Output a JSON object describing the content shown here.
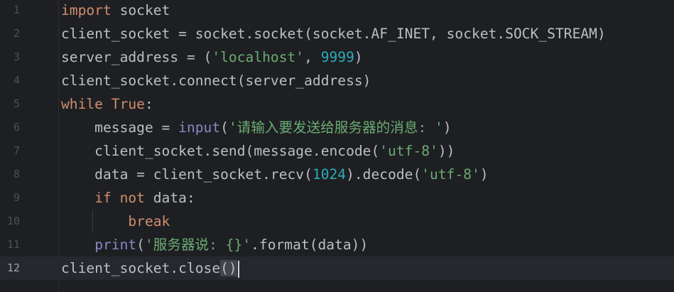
{
  "editor": {
    "lines": [
      {
        "num": "1",
        "tokens": [
          {
            "t": "import",
            "c": "kw"
          },
          {
            "t": " socket",
            "c": ""
          }
        ]
      },
      {
        "num": "2",
        "tokens": [
          {
            "t": "client_socket = socket.socket(socket.AF_INET, socket.SOCK_STREAM)",
            "c": ""
          }
        ]
      },
      {
        "num": "3",
        "tokens": [
          {
            "t": "server_address = (",
            "c": ""
          },
          {
            "t": "'localhost'",
            "c": "str"
          },
          {
            "t": ", ",
            "c": ""
          },
          {
            "t": "9999",
            "c": "num"
          },
          {
            "t": ")",
            "c": ""
          }
        ]
      },
      {
        "num": "4",
        "tokens": [
          {
            "t": "client_socket.connect(server_address)",
            "c": ""
          }
        ]
      },
      {
        "num": "5",
        "tokens": [
          {
            "t": "while",
            "c": "kw"
          },
          {
            "t": " ",
            "c": ""
          },
          {
            "t": "True",
            "c": "kw"
          },
          {
            "t": ":",
            "c": ""
          }
        ]
      },
      {
        "num": "6",
        "tokens": [
          {
            "t": "    message = ",
            "c": ""
          },
          {
            "t": "input",
            "c": "bi"
          },
          {
            "t": "(",
            "c": ""
          },
          {
            "t": "'请输入要发送给服务器的消息: '",
            "c": "str"
          },
          {
            "t": ")",
            "c": ""
          }
        ]
      },
      {
        "num": "7",
        "tokens": [
          {
            "t": "    client_socket.send(message.encode(",
            "c": ""
          },
          {
            "t": "'utf-8'",
            "c": "str"
          },
          {
            "t": "))",
            "c": ""
          }
        ]
      },
      {
        "num": "8",
        "tokens": [
          {
            "t": "    data = client_socket.recv(",
            "c": ""
          },
          {
            "t": "1024",
            "c": "num"
          },
          {
            "t": ").decode(",
            "c": ""
          },
          {
            "t": "'utf-8'",
            "c": "str"
          },
          {
            "t": ")",
            "c": ""
          }
        ]
      },
      {
        "num": "9",
        "tokens": [
          {
            "t": "    ",
            "c": ""
          },
          {
            "t": "if",
            "c": "kw"
          },
          {
            "t": " ",
            "c": ""
          },
          {
            "t": "not",
            "c": "kw"
          },
          {
            "t": " data:",
            "c": ""
          }
        ]
      },
      {
        "num": "10",
        "tokens": [
          {
            "t": "        ",
            "c": ""
          },
          {
            "t": "break",
            "c": "kw"
          }
        ]
      },
      {
        "num": "11",
        "tokens": [
          {
            "t": "    ",
            "c": ""
          },
          {
            "t": "print",
            "c": "bi"
          },
          {
            "t": "(",
            "c": ""
          },
          {
            "t": "'服务器说: {}'",
            "c": "str"
          },
          {
            "t": ".format(data))",
            "c": ""
          }
        ]
      },
      {
        "num": "12",
        "tokens": [
          {
            "t": "client_socket.close",
            "c": ""
          },
          {
            "t": "()",
            "c": "brace-hl"
          }
        ],
        "current": true,
        "caret": true
      }
    ]
  },
  "colors": {
    "background": "#1e1f22",
    "keyword": "#cf8e6d",
    "string": "#6aab73",
    "number": "#2aacb8",
    "builtin": "#8888c6",
    "text": "#bcbec4",
    "line_number": "#4b5059"
  }
}
